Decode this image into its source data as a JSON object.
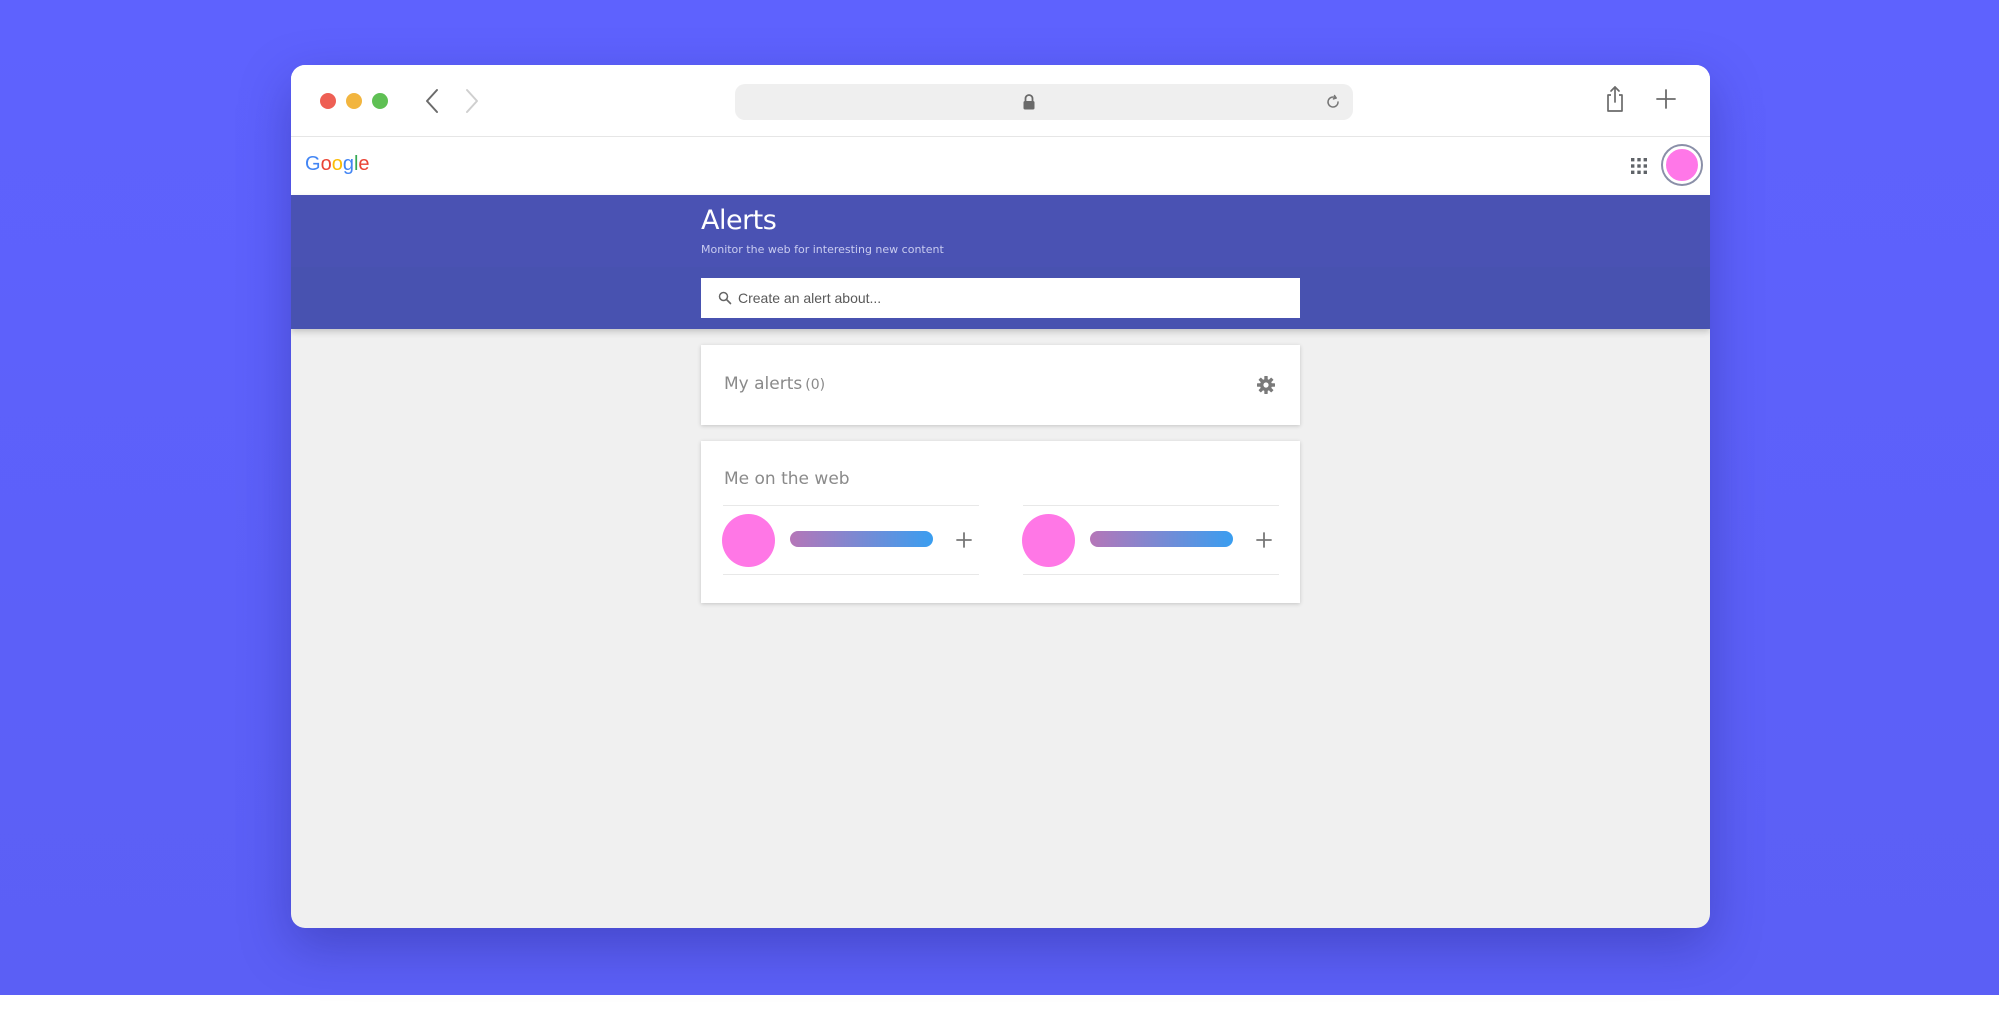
{
  "colors": {
    "backdrop": "#5e62fe",
    "header_blue": "#4a52b3",
    "avatar_pink": "#ff77e8",
    "traffic_red": "#ee5f54",
    "traffic_yellow": "#f2b53f",
    "traffic_green": "#5fc054"
  },
  "browser": {
    "icons": [
      "back-icon",
      "forward-icon",
      "lock-icon",
      "reload-icon",
      "share-icon",
      "new-tab-icon"
    ]
  },
  "google_bar": {
    "logo": "Google",
    "icons": [
      "apps-grid-icon",
      "account-avatar"
    ]
  },
  "header": {
    "title": "Alerts",
    "subtitle": "Monitor the web for interesting new content",
    "search_placeholder": "Create an alert about..."
  },
  "my_alerts": {
    "title": "My alerts",
    "count": "(0)",
    "icon": "gear-icon"
  },
  "me_on_web": {
    "title": "Me on the web",
    "suggestions": [
      {
        "icon": "plus-icon"
      },
      {
        "icon": "plus-icon"
      }
    ]
  }
}
